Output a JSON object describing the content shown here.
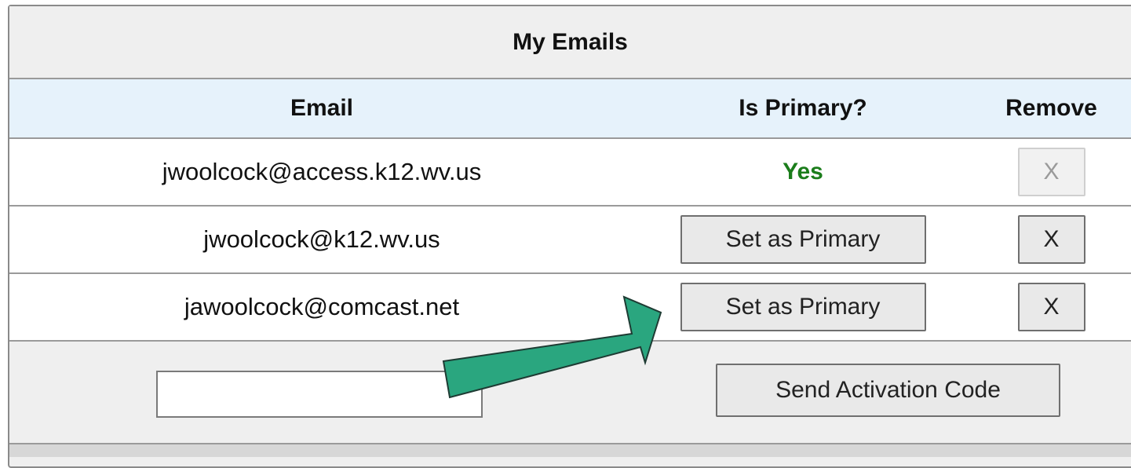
{
  "panel": {
    "title": "My Emails"
  },
  "table": {
    "headers": {
      "email": "Email",
      "is_primary": "Is Primary?",
      "remove": "Remove"
    },
    "rows": [
      {
        "email": "jwoolcock@access.k12.wv.us",
        "primary_status": "Yes",
        "remove_label": "X",
        "remove_enabled": false
      },
      {
        "email": "jwoolcock@k12.wv.us",
        "set_primary_label": "Set as Primary",
        "remove_label": "X",
        "remove_enabled": true
      },
      {
        "email": "jawoolcock@comcast.net",
        "set_primary_label": "Set as Primary",
        "remove_label": "X",
        "remove_enabled": true
      }
    ]
  },
  "footer": {
    "new_email_value": "",
    "send_activation_label": "Send Activation Code"
  },
  "annotation": {
    "arrow_color": "#2aa67f",
    "arrow_outline": "#1e3b33"
  },
  "colors": {
    "header_bg": "#e6f2fb",
    "yes_green": "#1b7d1b"
  }
}
